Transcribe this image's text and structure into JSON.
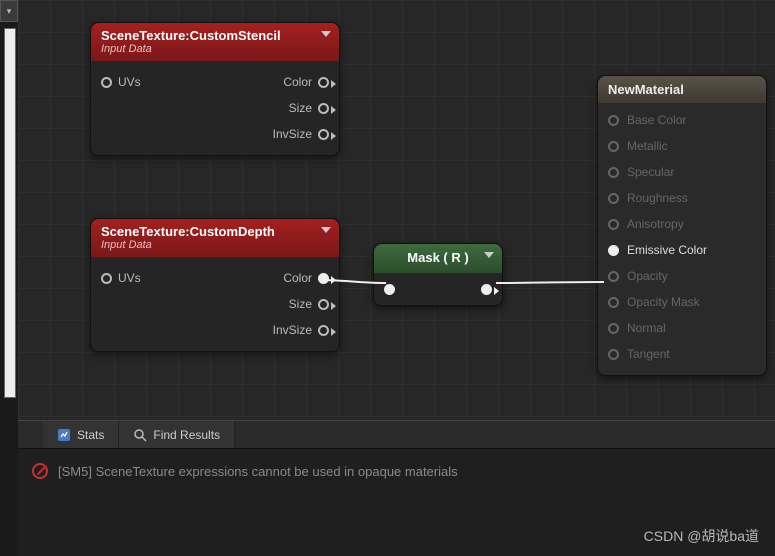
{
  "top_strip_glyph": "▾",
  "nodes": {
    "stencil": {
      "title": "SceneTexture:CustomStencil",
      "subtitle": "Input Data",
      "in_uv": "UVs",
      "out_color": "Color",
      "out_size": "Size",
      "out_invsize": "InvSize"
    },
    "depth": {
      "title": "SceneTexture:CustomDepth",
      "subtitle": "Input Data",
      "in_uv": "UVs",
      "out_color": "Color",
      "out_size": "Size",
      "out_invsize": "InvSize"
    },
    "mask": {
      "title": "Mask ( R )"
    }
  },
  "output": {
    "title": "NewMaterial",
    "pins": [
      {
        "label": "Base Color",
        "active": false
      },
      {
        "label": "Metallic",
        "active": false
      },
      {
        "label": "Specular",
        "active": false
      },
      {
        "label": "Roughness",
        "active": false
      },
      {
        "label": "Anisotropy",
        "active": false
      },
      {
        "label": "Emissive Color",
        "active": true
      },
      {
        "label": "Opacity",
        "active": false
      },
      {
        "label": "Opacity Mask",
        "active": false
      },
      {
        "label": "Normal",
        "active": false
      },
      {
        "label": "Tangent",
        "active": false
      }
    ]
  },
  "tabs": {
    "stats": "Stats",
    "find": "Find Results"
  },
  "error": "[SM5] SceneTexture expressions cannot be used in opaque materials",
  "watermark": "CSDN @胡说ba道"
}
